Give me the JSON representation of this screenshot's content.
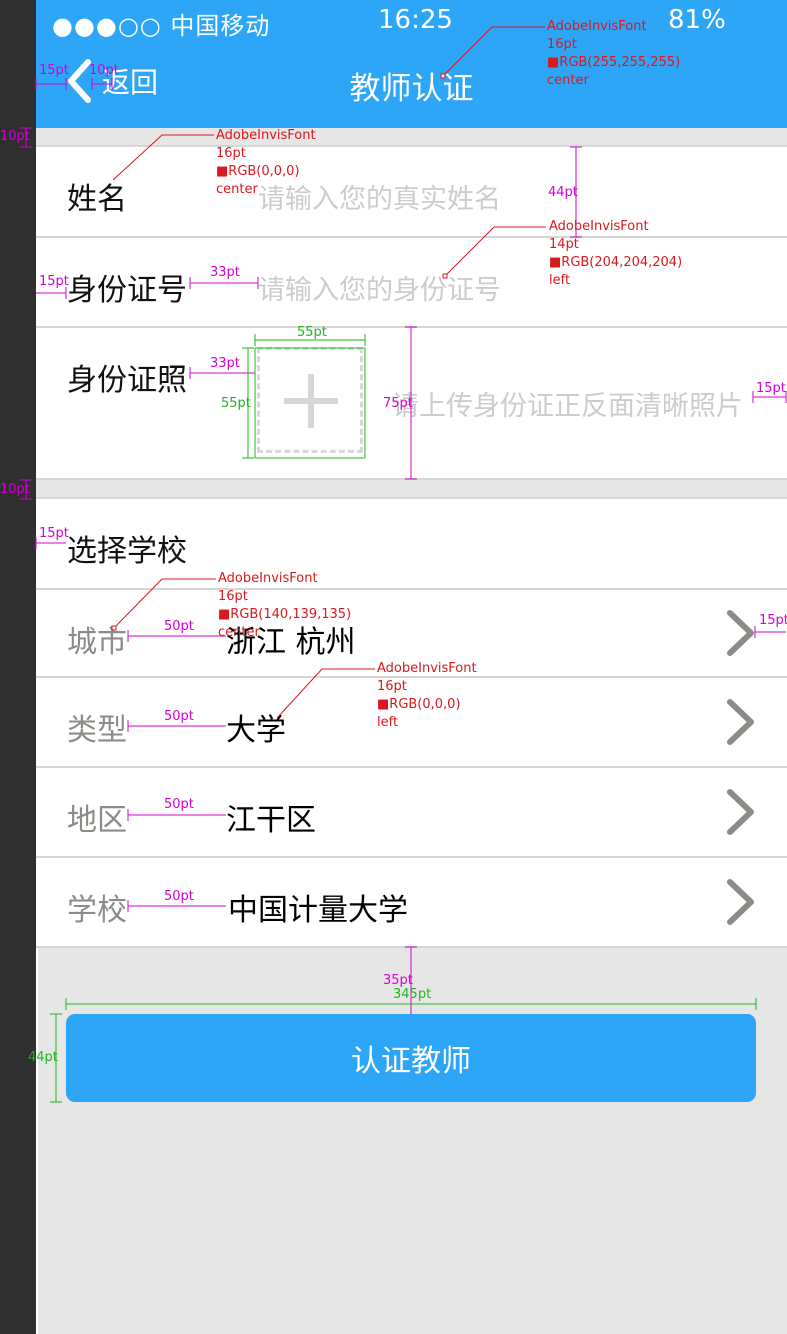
{
  "status_bar": {
    "carrier": "●●●○○ 中国移动",
    "time": "16:25",
    "battery": "81%"
  },
  "nav": {
    "back_label": "返回",
    "title": "教师认证"
  },
  "form": {
    "name": {
      "label": "姓名",
      "placeholder": "请输入您的真实姓名"
    },
    "id_number": {
      "label": "身份证号",
      "placeholder": "请输入您的身份证号"
    },
    "id_photo": {
      "label": "身份证照",
      "hint": "请上传身份证正反面清晰照片",
      "upload_symbol": "+"
    }
  },
  "school": {
    "section_label": "选择学校",
    "rows": [
      {
        "label": "城市",
        "value": "浙江 杭州"
      },
      {
        "label": "类型",
        "value": "大学"
      },
      {
        "label": "地区",
        "value": "江干区"
      },
      {
        "label": "学校",
        "value": "中国计量大学"
      }
    ]
  },
  "submit_label": "认证教师",
  "spec_annotations": {
    "title_font": "AdobeInvisFont\n16pt\n■RGB(255,255,255)\ncenter",
    "label_font": "AdobeInvisFont\n16pt\n■RGB(0,0,0)\ncenter",
    "placeholder_font": "AdobeInvisFont\n14pt\n■RGB(204,204,204)\nleft",
    "secondary_font": "AdobeInvisFont\n16pt\n■RGB(140,139,135)\ncenter",
    "value_font": "AdobeInvisFont\n16pt\n■RGB(0,0,0)\nleft",
    "dims": {
      "back_left": "15pt",
      "back_gap": "10pt",
      "gap_top": "10pt",
      "row_height": "44pt",
      "id_left": "15pt",
      "id_gap": "33pt",
      "photo_gap": "33pt",
      "box_width": "55pt",
      "box_height": "55pt",
      "photo_row": "75pt",
      "hint_right": "15pt",
      "gap_mid": "10pt",
      "school_left": "15pt",
      "city_gap": "50pt",
      "chev_right": "15pt",
      "type_gap": "50pt",
      "area_gap": "50pt",
      "school_gap": "50pt",
      "button_top": "35pt",
      "button_width": "345pt",
      "button_height": "44pt"
    }
  },
  "colors": {
    "primary": "#2ea6f8",
    "placeholder": "#cccccc",
    "secondary": "#8c8b87",
    "background": "#e6e6e6"
  }
}
